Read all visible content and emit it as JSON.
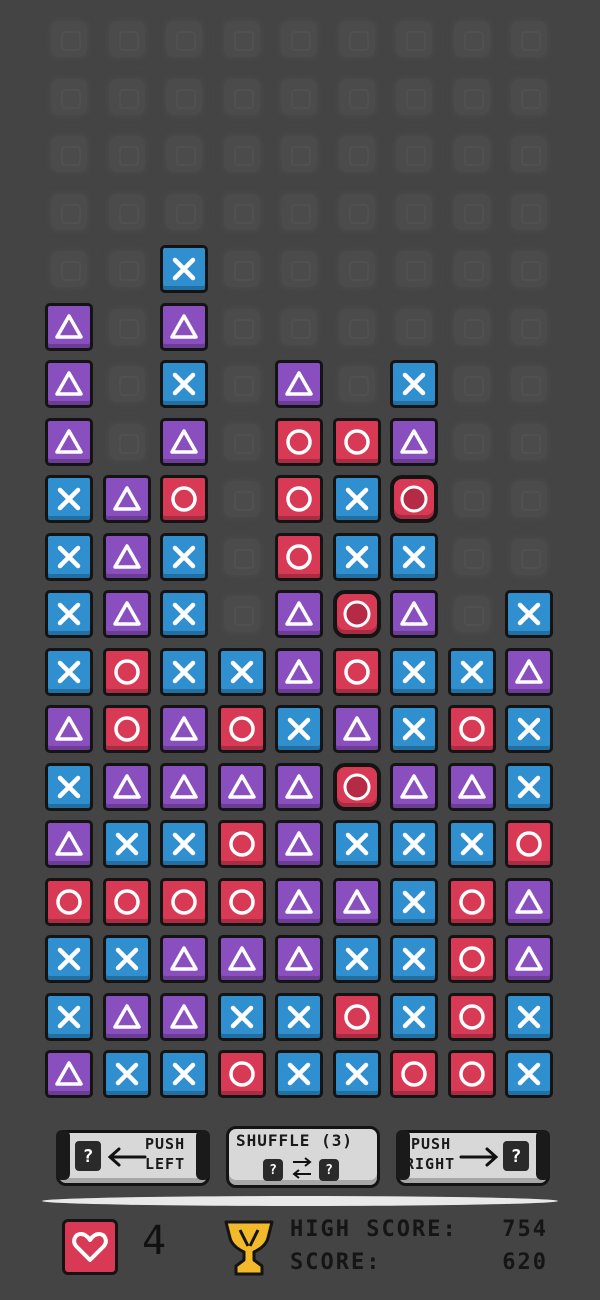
{
  "board": {
    "columns": 9,
    "rows": 19,
    "legend": {
      "x": "cross",
      "t": "triangle",
      "o": "circle"
    },
    "column_tiles_top_to_bottom": [
      [
        "t",
        "t",
        "t",
        "x",
        "x",
        "x",
        "x",
        "t",
        "x",
        "t",
        "o",
        "x",
        "x",
        "t"
      ],
      [
        "t",
        "t",
        "t",
        "o",
        "o",
        "t",
        "x",
        "o",
        "x",
        "t",
        "x"
      ],
      [
        "x",
        "t",
        "x",
        "t",
        "o",
        "x",
        "x",
        "x",
        "t",
        "t",
        "x",
        "o",
        "t",
        "t",
        "x"
      ],
      [
        "x",
        "o",
        "t",
        "o",
        "o",
        "t",
        "x",
        "o"
      ],
      [
        "t",
        "o",
        "o",
        "o",
        "t",
        "t",
        "x",
        "t",
        "t",
        "t",
        "t",
        "x",
        "x"
      ],
      [
        "o",
        "x",
        "x",
        "o*",
        "o",
        "t",
        "o*",
        "x",
        "t",
        "x",
        "o",
        "x"
      ],
      [
        "x",
        "t",
        "o*",
        "x",
        "t",
        "x",
        "x",
        "t",
        "x",
        "x",
        "x",
        "x",
        "o"
      ],
      [
        "x",
        "o",
        "t",
        "x",
        "o",
        "o",
        "o",
        "o"
      ],
      [
        "x",
        "t",
        "x",
        "x",
        "o",
        "t",
        "t",
        "x",
        "x"
      ]
    ],
    "bomb_note": "o* = circle tile with dark frame"
  },
  "controls": {
    "push_left": {
      "label_line1": "PUSH",
      "label_line2": "LEFT",
      "icon": "question-mark-box"
    },
    "shuffle": {
      "label": "SHUFFLE (3)",
      "icon": "question-mark-box"
    },
    "push_right": {
      "label_line1": "PUSH",
      "label_line2": "RIGHT",
      "icon": "question-mark-box"
    }
  },
  "status": {
    "lives": "4",
    "lives_icon": "heart-icon",
    "trophy_icon": "trophy-icon",
    "high_score_label": "HIGH SCORE:",
    "high_score": "754",
    "score_label": "SCORE:",
    "score": "620"
  },
  "colors": {
    "background": "#444444",
    "cross": "#2f8fcf",
    "triangle": "#8a4fbf",
    "circle": "#d83a55",
    "trophy": "#f2b92a"
  }
}
